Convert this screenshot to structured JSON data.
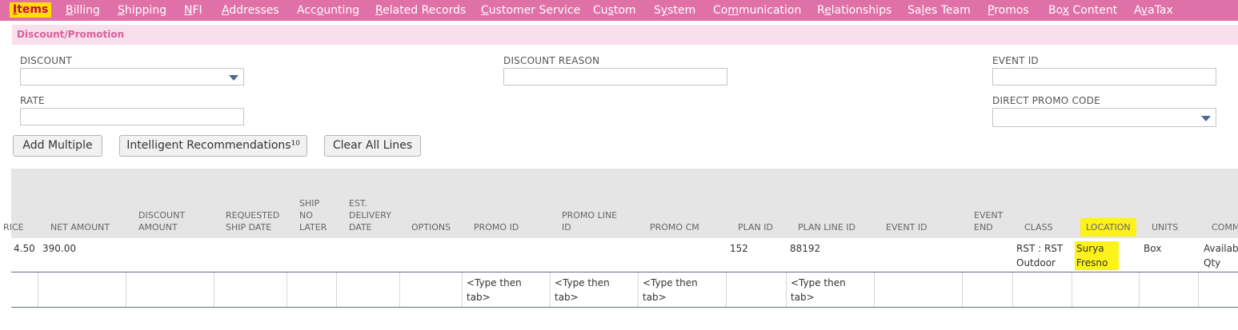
{
  "tabs": [
    {
      "pre": "",
      "acc": "I",
      "post": "tems",
      "active": true
    },
    {
      "pre": "",
      "acc": "B",
      "post": "illing"
    },
    {
      "pre": "",
      "acc": "S",
      "post": "hipping"
    },
    {
      "pre": "",
      "acc": "N",
      "post": "FI"
    },
    {
      "pre": "",
      "acc": "A",
      "post": "ddresses"
    },
    {
      "pre": "Acc",
      "acc": "o",
      "post": "unting"
    },
    {
      "pre": "",
      "acc": "R",
      "post": "elated Records"
    },
    {
      "pre": "",
      "acc": "C",
      "post": "ustomer Service"
    },
    {
      "pre": "Cu",
      "acc": "s",
      "post": "tom"
    },
    {
      "pre": "S",
      "acc": "y",
      "post": "stem"
    },
    {
      "pre": "Co",
      "acc": "m",
      "post": "munication"
    },
    {
      "pre": "R",
      "acc": "e",
      "post": "lationships"
    },
    {
      "pre": "Sa",
      "acc": "l",
      "post": "es Team"
    },
    {
      "pre": "",
      "acc": "P",
      "post": "romos"
    },
    {
      "pre": "Bo",
      "acc": "x",
      "post": " Content"
    },
    {
      "pre": "A",
      "acc": "v",
      "post": "aTax"
    }
  ],
  "section": {
    "title": "Discount/Promotion"
  },
  "fields": {
    "discount_label": "DISCOUNT",
    "discount_value": "",
    "rate_label": "RATE",
    "rate_value": "",
    "discount_reason_label": "DISCOUNT REASON",
    "discount_reason_value": "",
    "event_id_label": "EVENT ID",
    "event_id_value": "",
    "direct_promo_label": "DIRECT PROMO CODE",
    "direct_promo_value": ""
  },
  "buttons": {
    "add_multiple": "Add Multiple",
    "intelligent_recs": "Intelligent Recommendations¹⁰",
    "clear_all": "Clear All Lines"
  },
  "table": {
    "headers": [
      {
        "key": "rice",
        "text": "RICE"
      },
      {
        "key": "net_amount",
        "text": "NET AMOUNT"
      },
      {
        "key": "discount_amount",
        "text": "DISCOUNT\nAMOUNT"
      },
      {
        "key": "requested_ship",
        "text": "REQUESTED\nSHIP DATE"
      },
      {
        "key": "ship_no_later",
        "text": "SHIP\nNO\nLATER"
      },
      {
        "key": "est_delivery",
        "text": "EST.\nDELIVERY\nDATE"
      },
      {
        "key": "options",
        "text": "OPTIONS"
      },
      {
        "key": "promo_id",
        "text": "PROMO ID"
      },
      {
        "key": "promo_line_id",
        "text": "PROMO LINE\nID"
      },
      {
        "key": "promo_cm",
        "text": "PROMO CM"
      },
      {
        "key": "plan_id",
        "text": "PLAN ID"
      },
      {
        "key": "plan_line_id",
        "text": "PLAN LINE ID"
      },
      {
        "key": "event_id",
        "text": "EVENT ID"
      },
      {
        "key": "event_end",
        "text": "EVENT\nEND"
      },
      {
        "key": "class",
        "text": "CLASS"
      },
      {
        "key": "location",
        "text": "LOCATION"
      },
      {
        "key": "units",
        "text": "UNITS"
      },
      {
        "key": "comm",
        "text": "COMM"
      }
    ],
    "row": {
      "rice": "4.50",
      "net_amount": "390.00",
      "plan_id": "152",
      "plan_line_id": "88192",
      "class": "RST : RST\nOutdoor",
      "location": "Surya\nFresno",
      "units": "Box",
      "comm": "Availab\nQty"
    },
    "edit_placeholder": "<Type then\ntab>"
  }
}
